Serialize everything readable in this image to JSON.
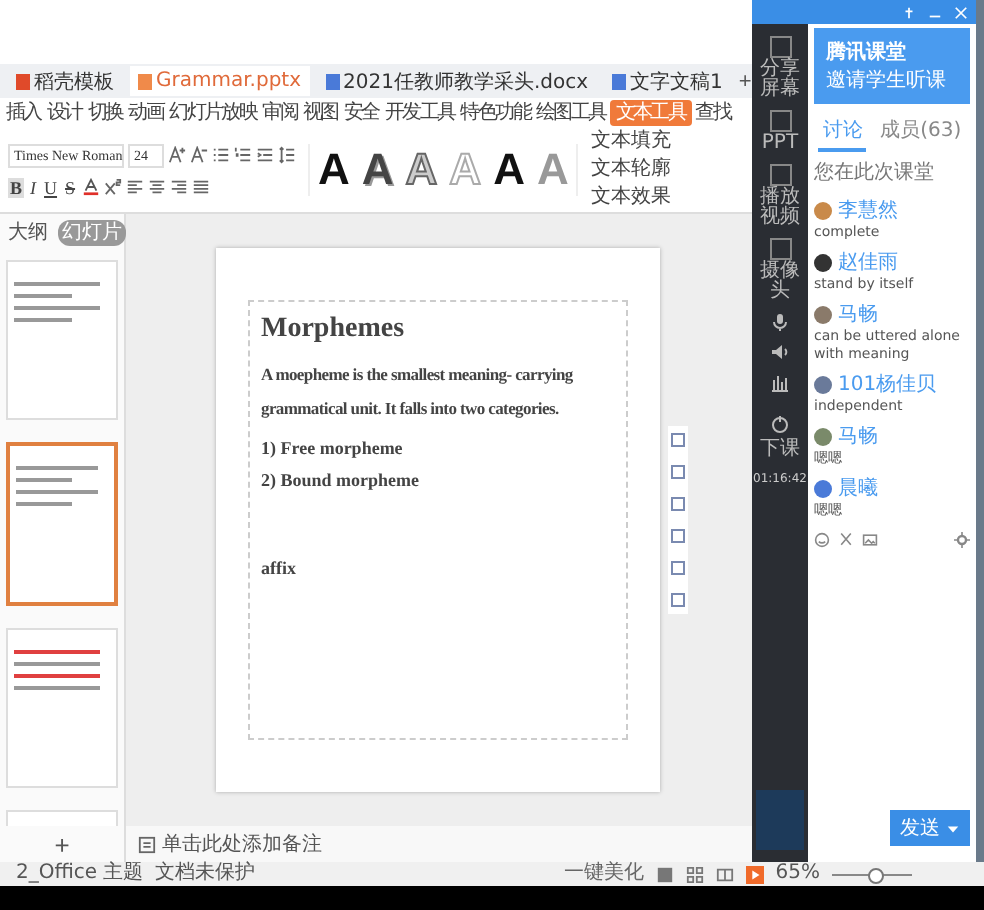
{
  "tabs": [
    {
      "label": "稻壳模板",
      "selected": false
    },
    {
      "label": "Grammar.pptx",
      "selected": true
    },
    {
      "label": "2021任教师教学采头.docx",
      "selected": false
    },
    {
      "label": "文字文稿1",
      "selected": false
    }
  ],
  "ribbon_tabs": [
    {
      "label": "插入",
      "selected": false
    },
    {
      "label": "设计",
      "selected": false
    },
    {
      "label": "切换",
      "selected": false
    },
    {
      "label": "动画",
      "selected": false
    },
    {
      "label": "幻灯片放映",
      "selected": false
    },
    {
      "label": "审阅",
      "selected": false
    },
    {
      "label": "视图",
      "selected": false
    },
    {
      "label": "安全",
      "selected": false
    },
    {
      "label": "开发工具",
      "selected": false
    },
    {
      "label": "特色功能",
      "selected": false
    },
    {
      "label": "绘图工具",
      "selected": false
    },
    {
      "label": "文本工具",
      "selected": true
    },
    {
      "label": "查找",
      "selected": false
    }
  ],
  "new_tab": "+",
  "add_slide": "+",
  "font": {
    "name": "Times New Roman",
    "size": "24"
  },
  "format_buttons": [
    "B",
    "I",
    "U",
    "S"
  ],
  "text_styles": [
    {
      "label": "A",
      "kind": "solid"
    },
    {
      "label": "A",
      "kind": "dark"
    },
    {
      "label": "A",
      "kind": "outline"
    },
    {
      "label": "A",
      "kind": "light"
    },
    {
      "label": "A",
      "kind": "solid"
    },
    {
      "label": "A",
      "kind": "grey"
    }
  ],
  "text_tools": [
    "文本填充",
    "文本轮廓",
    "文本效果"
  ],
  "panel_tabs": [
    {
      "label": "大纲",
      "selected": false
    },
    {
      "label": "幻灯片",
      "selected": true
    }
  ],
  "slides": [
    {
      "selected": false,
      "kind": "plain"
    },
    {
      "selected": true,
      "kind": "plain"
    },
    {
      "selected": false,
      "kind": "red"
    },
    {
      "selected": false,
      "kind": "plain"
    }
  ],
  "slide": {
    "title": "Morphemes",
    "body": "A moepheme is the smallest meaning- carrying grammatical unit. It falls into two categories.",
    "items": [
      "1) Free morpheme",
      "2) Bound morpheme"
    ],
    "note": "affix"
  },
  "notes_placeholder": "单击此处添加备注",
  "status_bar": {
    "theme": "2_Office 主题",
    "protection": "文档未保护",
    "beautify": "一键美化",
    "zoom": "65%",
    "zoom_slider": {
      "level": 0.55
    }
  },
  "classroom": {
    "logo": "腾讯课堂",
    "banner": "邀请学生听课",
    "tools": [
      "分享屏幕",
      "PPT",
      "播放视频",
      "摄像头"
    ],
    "end_class": "下课",
    "timer": "01:16:42",
    "tabs": [
      {
        "label": "讨论",
        "selected": true
      },
      {
        "label": "成员(63)",
        "selected": false
      }
    ],
    "notice": "您在此次课堂",
    "messages": [
      {
        "name": "李慧然",
        "text": "complete"
      },
      {
        "name": "赵佳雨",
        "text": "stand by itself"
      },
      {
        "name": "马畅",
        "text": "can be uttered alone with meaning"
      },
      {
        "name": "101杨佳贝",
        "text": "independent"
      },
      {
        "name": "马畅",
        "text": "嗯嗯"
      },
      {
        "name": "晨曦",
        "text": "嗯嗯"
      }
    ],
    "send": "发送"
  }
}
